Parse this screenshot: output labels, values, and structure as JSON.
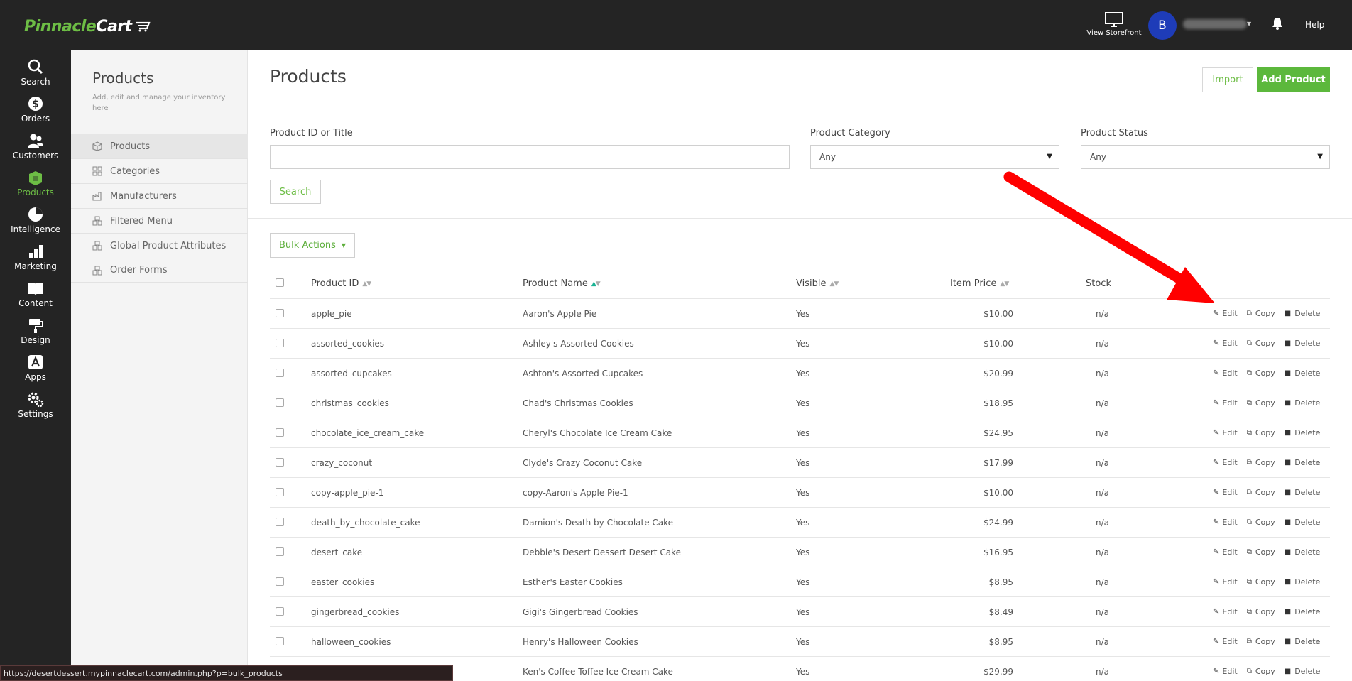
{
  "app": {
    "logo_primary": "Pinnacle",
    "logo_secondary": "Cart",
    "accent_color": "#6dbd45"
  },
  "topbar": {
    "storefront_label": "View Storefront",
    "avatar_initial": "B",
    "help_label": "Help",
    "icons": [
      "monitor-icon",
      "bell-icon",
      "caret-down-icon"
    ]
  },
  "leftnav": {
    "items": [
      {
        "label": "Search",
        "icon": "search-icon"
      },
      {
        "label": "Orders",
        "icon": "dollar-icon"
      },
      {
        "label": "Customers",
        "icon": "users-icon"
      },
      {
        "label": "Products",
        "icon": "products-icon",
        "active": true
      },
      {
        "label": "Intelligence",
        "icon": "pie-chart-icon"
      },
      {
        "label": "Marketing",
        "icon": "bar-chart-icon"
      },
      {
        "label": "Content",
        "icon": "book-icon"
      },
      {
        "label": "Design",
        "icon": "paint-icon"
      },
      {
        "label": "Apps",
        "icon": "apps-icon"
      },
      {
        "label": "Settings",
        "icon": "gears-icon"
      }
    ]
  },
  "subnav": {
    "title": "Products",
    "description": "Add, edit and manage your inventory here",
    "items": [
      {
        "label": "Products",
        "active": true
      },
      {
        "label": "Categories"
      },
      {
        "label": "Manufacturers"
      },
      {
        "label": "Filtered Menu"
      },
      {
        "label": "Global Product Attributes"
      },
      {
        "label": "Order Forms"
      }
    ]
  },
  "main": {
    "title": "Products",
    "import_label": "Import",
    "add_label": "Add Product"
  },
  "filters": {
    "id_label": "Product ID or Title",
    "id_value": "",
    "category_label": "Product Category",
    "category_value": "Any",
    "status_label": "Product Status",
    "status_value": "Any",
    "search_label": "Search"
  },
  "bulk": {
    "label": "Bulk Actions"
  },
  "table": {
    "columns": {
      "id": "Product ID",
      "name": "Product Name",
      "visible": "Visible",
      "price": "Item Price",
      "stock": "Stock"
    },
    "sorted_column": "name",
    "actions": {
      "edit": "Edit",
      "copy": "Copy",
      "delete": "Delete"
    },
    "rows": [
      {
        "id": "apple_pie",
        "name": "Aaron's Apple Pie",
        "visible": "Yes",
        "price": "$10.00",
        "stock": "n/a"
      },
      {
        "id": "assorted_cookies",
        "name": "Ashley's Assorted Cookies",
        "visible": "Yes",
        "price": "$10.00",
        "stock": "n/a"
      },
      {
        "id": "assorted_cupcakes",
        "name": "Ashton's Assorted Cupcakes",
        "visible": "Yes",
        "price": "$20.99",
        "stock": "n/a"
      },
      {
        "id": "christmas_cookies",
        "name": "Chad's Christmas Cookies",
        "visible": "Yes",
        "price": "$18.95",
        "stock": "n/a"
      },
      {
        "id": "chocolate_ice_cream_cake",
        "name": "Cheryl's Chocolate Ice Cream Cake",
        "visible": "Yes",
        "price": "$24.95",
        "stock": "n/a"
      },
      {
        "id": "crazy_coconut",
        "name": "Clyde's Crazy Coconut Cake",
        "visible": "Yes",
        "price": "$17.99",
        "stock": "n/a"
      },
      {
        "id": "copy-apple_pie-1",
        "name": "copy-Aaron's Apple Pie-1",
        "visible": "Yes",
        "price": "$10.00",
        "stock": "n/a"
      },
      {
        "id": "death_by_chocolate_cake",
        "name": "Damion's Death by Chocolate Cake",
        "visible": "Yes",
        "price": "$24.99",
        "stock": "n/a"
      },
      {
        "id": "desert_cake",
        "name": "Debbie's Desert Dessert Desert Cake",
        "visible": "Yes",
        "price": "$16.95",
        "stock": "n/a"
      },
      {
        "id": "easter_cookies",
        "name": "Esther's Easter Cookies",
        "visible": "Yes",
        "price": "$8.95",
        "stock": "n/a"
      },
      {
        "id": "gingerbread_cookies",
        "name": "Gigi's Gingerbread Cookies",
        "visible": "Yes",
        "price": "$8.49",
        "stock": "n/a"
      },
      {
        "id": "halloween_cookies",
        "name": "Henry's Halloween Cookies",
        "visible": "Yes",
        "price": "$8.95",
        "stock": "n/a"
      },
      {
        "id": "",
        "name": "Ken's Coffee Toffee Ice Cream Cake",
        "visible": "Yes",
        "price": "$29.99",
        "stock": "n/a"
      }
    ]
  },
  "statusbar": {
    "url": "https://desertdessert.mypinnaclecart.com/admin.php?p=bulk_products"
  },
  "annotation": {
    "arrow_color": "#ff0000"
  }
}
